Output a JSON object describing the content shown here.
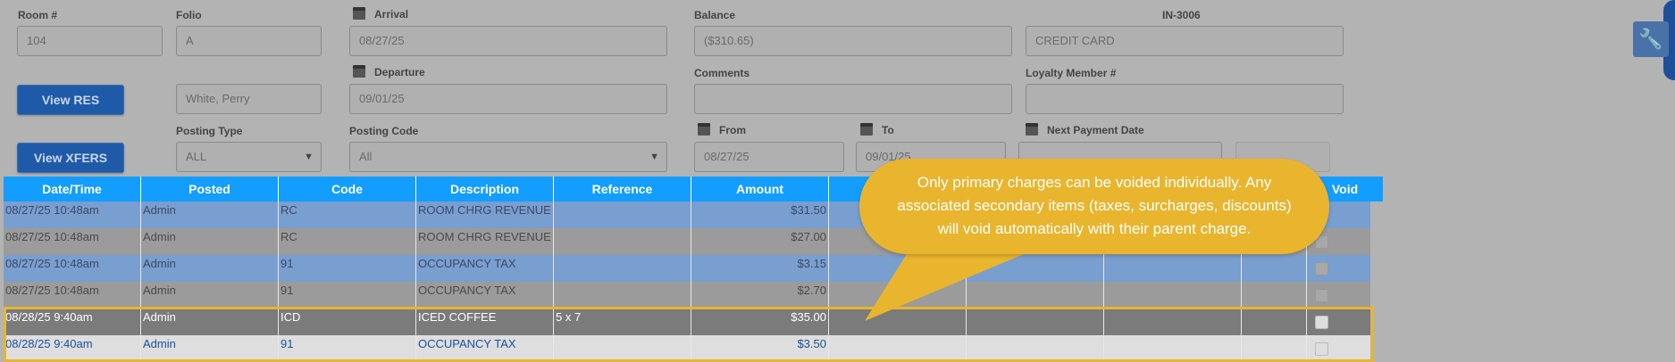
{
  "form": {
    "room": {
      "label": "Room #",
      "value": "104"
    },
    "folio": {
      "label": "Folio",
      "value": "A"
    },
    "arrival": {
      "label": "Arrival",
      "value": "08/27/25"
    },
    "balance": {
      "label": "Balance",
      "value": "($310.65)"
    },
    "ref_code": "IN-3006",
    "payment_method": {
      "value": "CREDIT CARD"
    },
    "guest_name": {
      "value": "White, Perry"
    },
    "departure": {
      "label": "Departure",
      "value": "09/01/25"
    },
    "comments": {
      "label": "Comments",
      "value": ""
    },
    "loyalty": {
      "label": "Loyalty Member #",
      "value": ""
    },
    "posting_type": {
      "label": "Posting Type",
      "value": "ALL"
    },
    "posting_code": {
      "label": "Posting Code",
      "value": "All"
    },
    "from": {
      "label": "From",
      "value": "08/27/25"
    },
    "to": {
      "label": "To",
      "value": "09/01/25"
    },
    "next_payment": {
      "label": "Next Payment Date",
      "value": ""
    }
  },
  "buttons": {
    "view_res": "View RES",
    "view_xfers": "View XFERS"
  },
  "icons": {
    "calendar": "calendar-icon",
    "wrench": "wrench-icon",
    "dropdown": "chevron-down-icon"
  },
  "grid": {
    "columns": [
      "Date/Time",
      "Posted",
      "Code",
      "Description",
      "Reference",
      "Amount",
      "",
      "",
      "",
      "",
      "Void"
    ],
    "rows": [
      {
        "datetime": "08/27/25 10:48am",
        "posted": "Admin",
        "code": "RC",
        "description": "ROOM CHRG REVENUE",
        "reference": "",
        "amount": "$31.50"
      },
      {
        "datetime": "08/27/25 10:48am",
        "posted": "Admin",
        "code": "RC",
        "description": "ROOM CHRG REVENUE",
        "reference": "",
        "amount": "$27.00"
      },
      {
        "datetime": "08/27/25 10:48am",
        "posted": "Admin",
        "code": "91",
        "description": "OCCUPANCY TAX",
        "reference": "",
        "amount": "$3.15"
      },
      {
        "datetime": "08/27/25 10:48am",
        "posted": "Admin",
        "code": "91",
        "description": "OCCUPANCY TAX",
        "reference": "",
        "amount": "$2.70"
      },
      {
        "datetime": "08/28/25 9:40am",
        "posted": "Admin",
        "code": "ICD",
        "description": "ICED COFFEE",
        "reference": "5 x 7",
        "amount": "$35.00"
      },
      {
        "datetime": "08/28/25 9:40am",
        "posted": "Admin",
        "code": "91",
        "description": "OCCUPANCY TAX",
        "reference": "",
        "amount": "$3.50"
      }
    ]
  },
  "callout": {
    "text": "Only primary charges can be voided individually. Any associated secondary items (taxes, surcharges, discounts) will void automatically with their parent charge."
  },
  "colors": {
    "header": "#129dff",
    "button": "#1f5aa8",
    "callout": "#e9b52e"
  }
}
